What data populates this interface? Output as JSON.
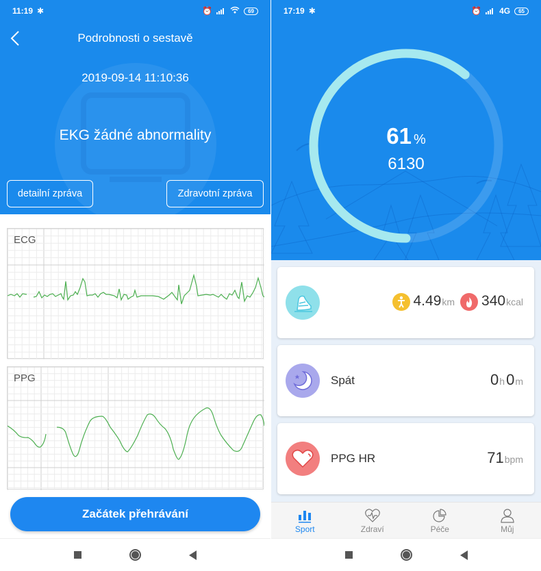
{
  "left_screen": {
    "status_bar": {
      "time": "11:19",
      "battery": "69",
      "icons": [
        "bluetooth-icon",
        "alarm-icon",
        "signal-icon",
        "wifi-icon",
        "battery-icon"
      ]
    },
    "header": {
      "title": "Podrobnosti o sestavě",
      "datetime": "2019-09-14 11:10:36",
      "result": "EKG žádné abnormality",
      "buttons": {
        "detail_report": "detailní zpráva",
        "health_report": "Zdravotní zpráva"
      }
    },
    "ecg_chart": {
      "label": "ECG",
      "color": "#4caf50"
    },
    "ppg_chart": {
      "label": "PPG",
      "color": "#4caf50"
    },
    "play_button": "Začátek přehrávání"
  },
  "right_screen": {
    "status_bar": {
      "time": "17:19",
      "network": "4G",
      "battery": "65",
      "icons": [
        "bluetooth-icon",
        "alarm-icon",
        "signal-icon",
        "battery-icon"
      ]
    },
    "goal": {
      "percent": "61",
      "percent_unit": "%",
      "progress_fraction": 0.61,
      "steps": "6130"
    },
    "activity_card": {
      "distance": "4.49",
      "distance_unit": "km",
      "calories": "340",
      "calories_unit": "kcal"
    },
    "sleep_card": {
      "label": "Spát",
      "hours": "0",
      "hours_unit": "h",
      "minutes": "0",
      "minutes_unit": "m"
    },
    "hr_card": {
      "label": "PPG HR",
      "value": "71",
      "unit": "bpm"
    },
    "tabs": [
      {
        "label": "Sport",
        "icon": "bar-chart-icon",
        "active": true
      },
      {
        "label": "Zdraví",
        "icon": "heart-pulse-icon",
        "active": false
      },
      {
        "label": "Péče",
        "icon": "pie-chart-icon",
        "active": false
      },
      {
        "label": "Můj",
        "icon": "user-icon",
        "active": false
      }
    ]
  },
  "colors": {
    "header_blue": "#1a8aec",
    "button_blue": "#1e87f0",
    "ring_fill": "#a6e9ef",
    "trace_green": "#4caf50",
    "activity_icon_bg": "#8fe0ea",
    "sleep_icon_bg": "#a9a8ec",
    "hr_icon_bg": "#f27f7f",
    "distance_badge": "#f5c02f",
    "calorie_badge": "#f06a6a"
  }
}
